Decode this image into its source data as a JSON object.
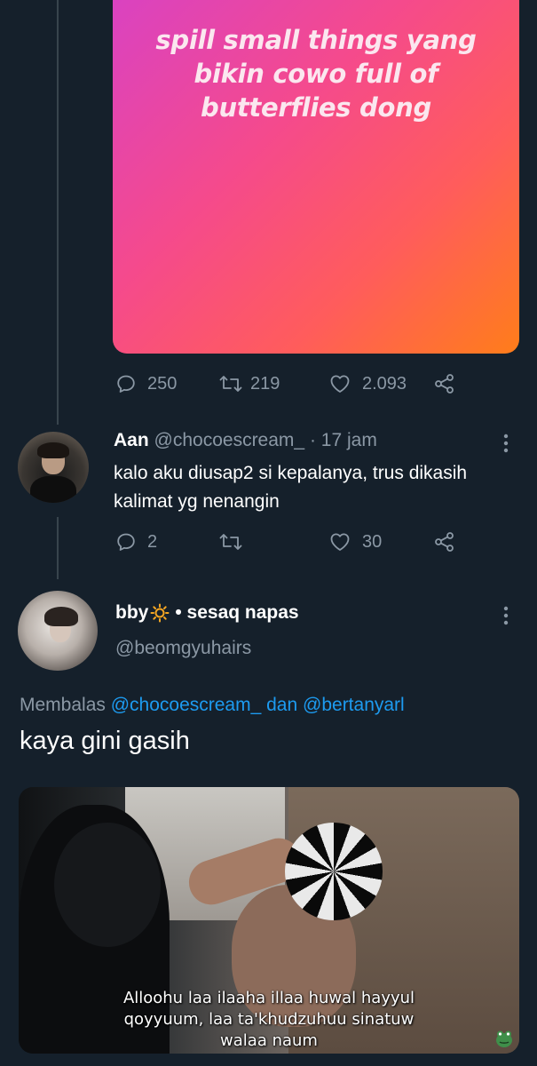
{
  "original_tweet": {
    "image_caption": "spill small things yang bikin cowo full of butterflies dong",
    "image_gradient": [
      "#d842c4",
      "#ff7d1a"
    ],
    "stats": {
      "replies": "250",
      "retweets": "219",
      "likes": "2.093"
    }
  },
  "reply1": {
    "name": "Aan",
    "handle": "@chocoescream_",
    "separator": "·",
    "time": "17 jam",
    "text": "kalo aku diusap2 si kepalanya, trus dikasih kalimat yg nenangin",
    "stats": {
      "replies": "2",
      "retweets": "",
      "likes": "30"
    }
  },
  "reply2": {
    "name": "bby",
    "name_suffix": "• sesaq napas",
    "handle": "@beomgyuhairs",
    "replying_prefix": "Membalas",
    "mention1": "@chocoescream_",
    "replying_joiner": "dan",
    "mention2": "@bertanyarl",
    "text": "kaya gini gasih",
    "media_subtitle_line1": "Alloohu laa ilaaha illaa huwal hayyul",
    "media_subtitle_line2": "qoyyuum, laa ta'khudzuhuu sinatuw",
    "media_subtitle_line3": "walaa naum"
  },
  "colors": {
    "background": "#15202b",
    "secondary_text": "#8b98a5",
    "link": "#1d9bf0",
    "thread_line": "#38444d"
  },
  "icons": [
    "reply-icon",
    "retweet-icon",
    "like-icon",
    "share-icon",
    "more-icon",
    "sun-icon",
    "frog-sticker-icon"
  ]
}
